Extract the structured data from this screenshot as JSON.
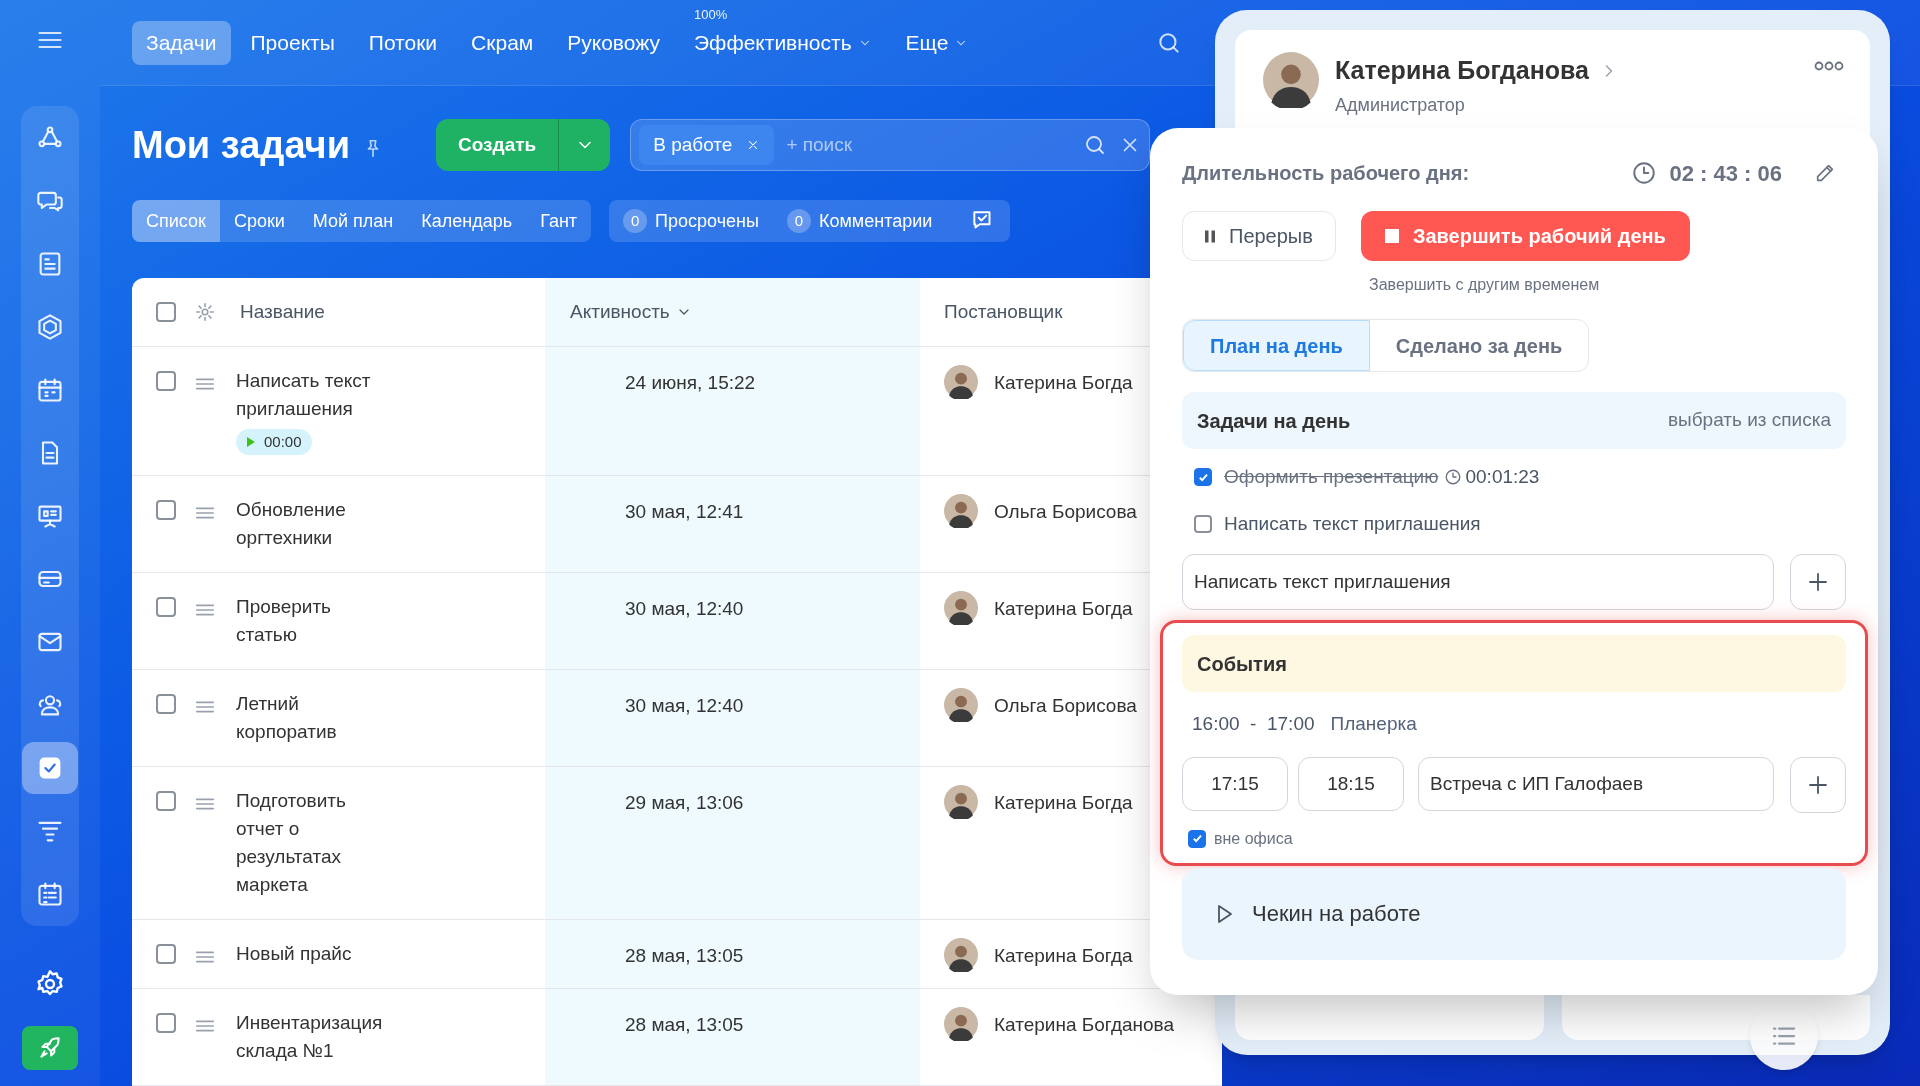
{
  "sidebar": {
    "items": [
      {
        "kind": "graph",
        "selected": false
      },
      {
        "kind": "chat",
        "selected": false
      },
      {
        "kind": "feed",
        "selected": false
      },
      {
        "kind": "hexagon",
        "selected": false
      },
      {
        "kind": "calendar",
        "selected": false
      },
      {
        "kind": "doc",
        "selected": false
      },
      {
        "kind": "board",
        "selected": false
      },
      {
        "kind": "card",
        "selected": false
      },
      {
        "kind": "mail",
        "selected": false
      },
      {
        "kind": "people",
        "selected": false
      },
      {
        "kind": "tasks",
        "selected": true
      },
      {
        "kind": "filter",
        "selected": false
      },
      {
        "kind": "planner",
        "selected": false
      }
    ]
  },
  "nav": {
    "items": [
      {
        "label": "Задачи",
        "selected": true,
        "caret": false
      },
      {
        "label": "Проекты",
        "selected": false,
        "caret": false
      },
      {
        "label": "Потоки",
        "selected": false,
        "caret": false
      },
      {
        "label": "Скрам",
        "selected": false,
        "caret": false
      },
      {
        "label": "Руковожу",
        "selected": false,
        "caret": false
      },
      {
        "label": "Эффективность",
        "selected": false,
        "caret": true,
        "badge": "100%"
      },
      {
        "label": "Еще",
        "selected": false,
        "caret": true
      }
    ]
  },
  "page": {
    "title": "Мои задачи",
    "create_button": "Создать",
    "filter_chip": "В работе",
    "search_placeholder": "+ поиск"
  },
  "view_tabs": [
    {
      "label": "Список",
      "selected": true
    },
    {
      "label": "Сроки",
      "selected": false
    },
    {
      "label": "Мой план",
      "selected": false
    },
    {
      "label": "Календарь",
      "selected": false
    },
    {
      "label": "Гант",
      "selected": false
    }
  ],
  "counters": [
    {
      "count": "0",
      "label": "Просрочены"
    },
    {
      "count": "0",
      "label": "Комментарии"
    }
  ],
  "table": {
    "select_all_checked": false,
    "columns": [
      "Название",
      "Активность",
      "Постановщик"
    ],
    "rows": [
      {
        "checked": false,
        "title": "Написать текст приглашения",
        "timer": "00:00",
        "activity": "24 июня, 15:22",
        "creator": "Катерина Богда"
      },
      {
        "checked": false,
        "title": "Обновление оргтехники",
        "activity": "30 мая, 12:41",
        "creator": "Ольга Борисова"
      },
      {
        "checked": false,
        "title": "Проверить статью",
        "activity": "30 мая, 12:40",
        "creator": "Катерина Богда"
      },
      {
        "checked": false,
        "title": "Летний корпоратив",
        "activity": "30 мая, 12:40",
        "creator": "Ольга Борисова"
      },
      {
        "checked": false,
        "title": "Подготовить отчет о результатах маркета",
        "activity": "29 мая, 13:06",
        "creator": "Катерина Богда"
      },
      {
        "checked": false,
        "title": "Новый прайс",
        "activity": "28 мая, 13:05",
        "creator": "Катерина Богда"
      },
      {
        "checked": false,
        "title": "Инвентаризация склада №1",
        "activity": "28 мая, 13:05",
        "creator": "Катерина Богданова"
      }
    ]
  },
  "profile": {
    "name": "Катерина Богданова",
    "role": "Администратор"
  },
  "workday": {
    "title": "Длительность рабочего дня:",
    "timer": "02 : 43 : 06",
    "pause_button": "Перерыв",
    "finish_button": "Завершить рабочий день",
    "finish_other": "Завершить с другим временем",
    "tabs": [
      {
        "label": "План на день",
        "selected": true
      },
      {
        "label": "Сделано за день",
        "selected": false
      }
    ],
    "tasks_title": "Задачи на день",
    "tasks_link": "выбрать из списка",
    "tasks": [
      {
        "label": "Оформить презентацию",
        "checked": true,
        "time": "00:01:23"
      },
      {
        "label": "Написать текст приглашения",
        "checked": false
      }
    ],
    "task_input": "Написать текст приглашения",
    "events": {
      "title": "События",
      "highlighted": true,
      "items": [
        {
          "time": "16:00  -  17:00",
          "title": "Планерка"
        }
      ],
      "new_start": "17:15",
      "new_end": "18:15",
      "new_title": "Встреча с ИП Галофаев",
      "out_of_office": true,
      "out_of_office_label": "вне офиса"
    },
    "checkin": "Чекин на работе"
  }
}
